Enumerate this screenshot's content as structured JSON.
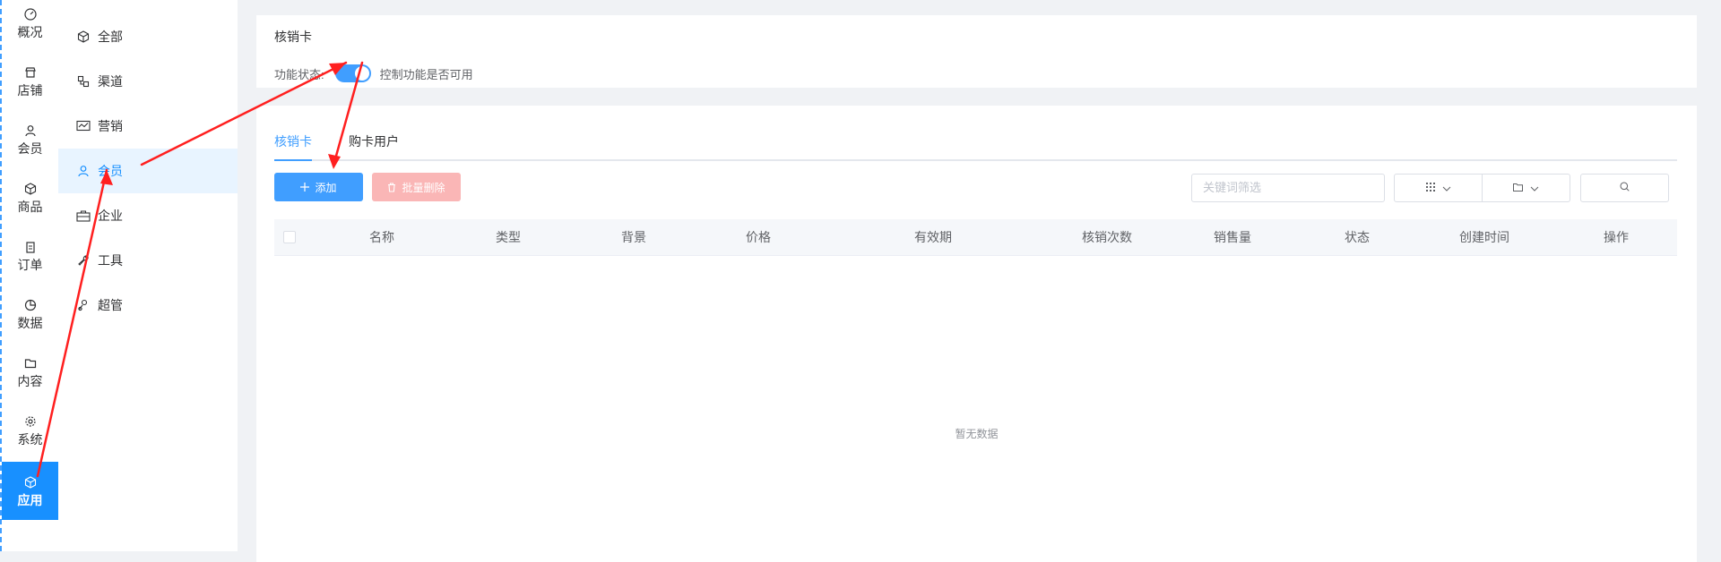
{
  "rail": {
    "items": [
      {
        "label": "概况",
        "icon": "dashboard-icon"
      },
      {
        "label": "店铺",
        "icon": "store-icon"
      },
      {
        "label": "会员",
        "icon": "user-icon"
      },
      {
        "label": "商品",
        "icon": "cube-icon"
      },
      {
        "label": "订单",
        "icon": "clipboard-icon"
      },
      {
        "label": "数据",
        "icon": "pie-chart-icon"
      },
      {
        "label": "内容",
        "icon": "folder-icon"
      },
      {
        "label": "系统",
        "icon": "gear-icon"
      },
      {
        "label": "应用",
        "icon": "cube-icon"
      }
    ],
    "active_index": 8,
    "active_color": "#1890ff"
  },
  "subnav": {
    "items": [
      {
        "label": "全部",
        "icon": "cube-icon"
      },
      {
        "label": "渠道",
        "icon": "channel-icon"
      },
      {
        "label": "营销",
        "icon": "chart-icon"
      },
      {
        "label": "会员",
        "icon": "user-icon"
      },
      {
        "label": "企业",
        "icon": "briefcase-icon"
      },
      {
        "label": "工具",
        "icon": "wrench-icon"
      },
      {
        "label": "超管",
        "icon": "admin-icon"
      }
    ],
    "active_index": 3
  },
  "feature": {
    "title": "核销卡",
    "status_label": "功能状态:",
    "switch_on": true,
    "status_desc": "控制功能是否可用"
  },
  "tabs": [
    "核销卡",
    "购卡用户"
  ],
  "active_tab": 0,
  "toolbar": {
    "add_label": "添加",
    "batch_delete_label": "批量删除",
    "search_placeholder": "关键词筛选"
  },
  "table": {
    "columns": [
      "名称",
      "类型",
      "背景",
      "价格",
      "有效期",
      "核销次数",
      "销售量",
      "状态",
      "创建时间",
      "操作"
    ],
    "empty_text": "暂无数据"
  },
  "colors": {
    "primary": "#409eff",
    "danger_disabled": "#fab6b6",
    "annotation": "#ff1f1f"
  }
}
